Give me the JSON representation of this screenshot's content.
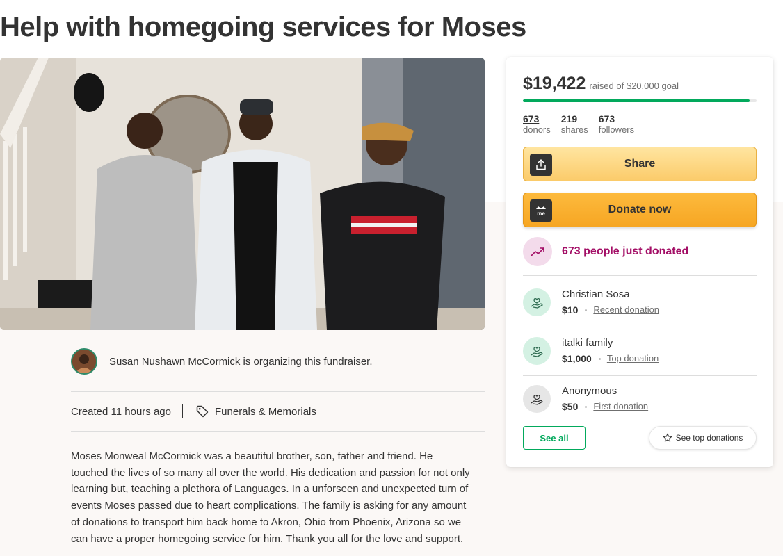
{
  "title": "Help with homegoing services for Moses",
  "organizer": {
    "text": "Susan Nushawn McCormick is organizing this fundraiser."
  },
  "meta": {
    "created": "Created 11 hours ago",
    "category": "Funerals & Memorials"
  },
  "story": [
    "Moses Monweal McCormick was a beautiful brother, son, father and friend. He",
    "touched the lives of so many all over the world. His dedication and passion for not only",
    "learning but, teaching a plethora of Languages.  In a unforseen and unexpected turn of",
    "events Moses passed due to heart complications.  The family is asking for any amount",
    "of donations to transport him back home to Akron, Ohio from Phoenix, Arizona so we",
    "can have a proper homegoing service for him. Thank you all for the love and support."
  ],
  "campaign": {
    "raised": "$19,422",
    "goal_text": "raised of $20,000 goal",
    "progress_fraction": 0.971,
    "stats": [
      {
        "num": "673",
        "label": "donors"
      },
      {
        "num": "219",
        "label": "shares"
      },
      {
        "num": "673",
        "label": "followers"
      }
    ],
    "share_label": "Share",
    "donate_label": "Donate now",
    "recent_label": "673 people just donated"
  },
  "donations": [
    {
      "name": "Christian Sosa",
      "amount": "$10",
      "type": "Recent donation"
    },
    {
      "name": "italki family",
      "amount": "$1,000",
      "type": "Top donation"
    },
    {
      "name": "Anonymous",
      "amount": "$50",
      "type": "First donation"
    }
  ],
  "buttons": {
    "see_all": "See all",
    "see_top": "See top donations"
  },
  "colors": {
    "accent_green": "#02a95c",
    "donate_orange": "#f6a623",
    "trend_magenta": "#a30e66"
  },
  "icons": {
    "share": "share-upload-icon",
    "donate": "gofundme-logo-icon",
    "trend": "trending-up-icon",
    "donor": "hand-heart-icon",
    "tag": "tag-icon",
    "star": "star-icon"
  }
}
